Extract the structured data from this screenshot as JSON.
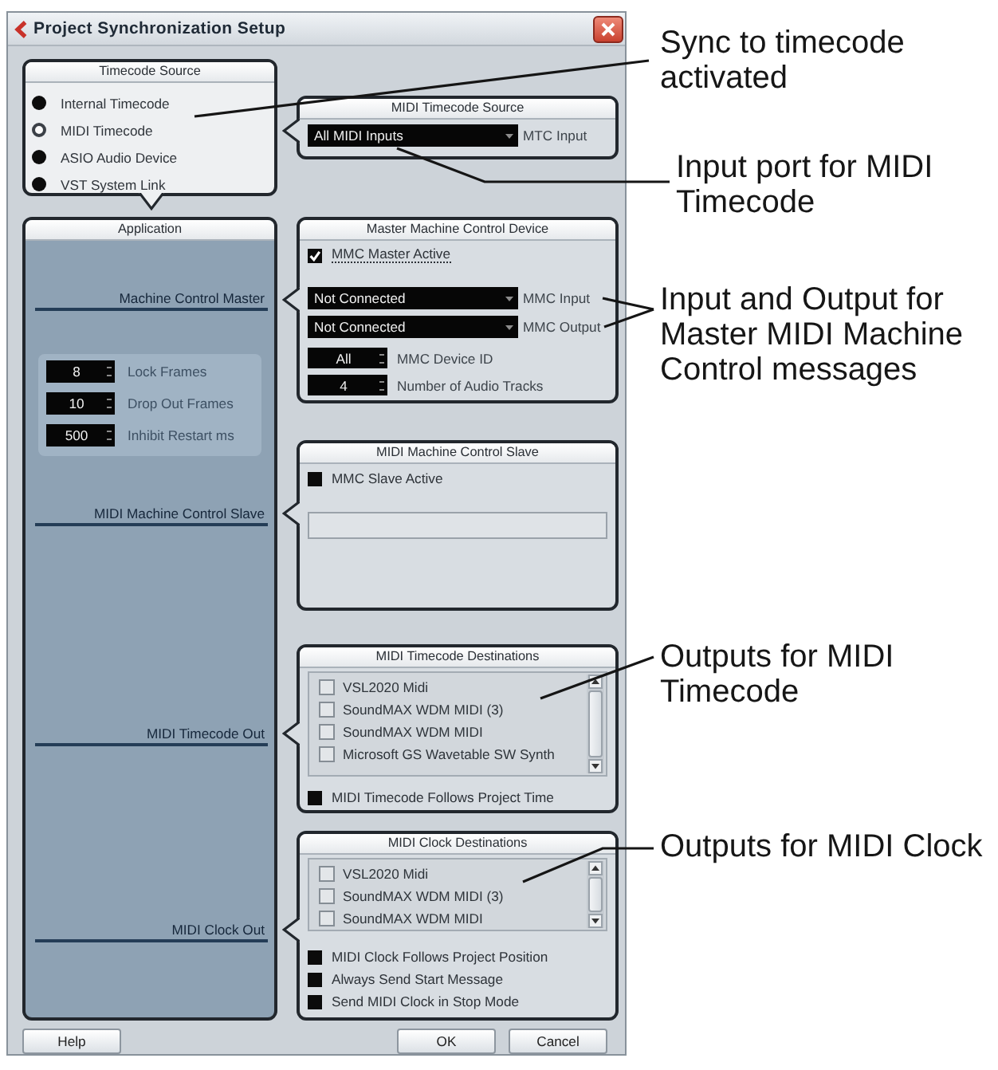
{
  "window": {
    "title": "Project Synchronization Setup"
  },
  "timecode_source": {
    "title": "Timecode Source",
    "options": [
      {
        "label": "Internal Timecode",
        "selected": false
      },
      {
        "label": "MIDI Timecode",
        "selected": true
      },
      {
        "label": "ASIO Audio Device",
        "selected": false
      },
      {
        "label": "VST System Link",
        "selected": false
      }
    ]
  },
  "midi_timecode_source": {
    "title": "MIDI Timecode Source",
    "input": {
      "value": "All MIDI Inputs",
      "label": "MTC Input"
    }
  },
  "application": {
    "title": "Application",
    "sections": [
      {
        "label": "Machine Control Master"
      },
      {
        "label": "MIDI Machine Control Slave"
      },
      {
        "label": "MIDI Timecode Out"
      },
      {
        "label": "MIDI Clock Out"
      }
    ],
    "frame_settings": [
      {
        "value": "8",
        "label": "Lock Frames"
      },
      {
        "value": "10",
        "label": "Drop Out Frames"
      },
      {
        "value": "500",
        "label": "Inhibit Restart ms"
      }
    ]
  },
  "master_machine_control": {
    "title": "Master Machine Control Device",
    "active": {
      "label": "MMC Master Active",
      "checked": true,
      "focused": true
    },
    "ports": [
      {
        "value": "Not Connected",
        "label": "MMC Input"
      },
      {
        "value": "Not Connected",
        "label": "MMC Output"
      }
    ],
    "settings": [
      {
        "value": "All",
        "label": "MMC Device ID"
      },
      {
        "value": "4",
        "label": "Number of Audio Tracks"
      }
    ]
  },
  "midi_machine_control_slave": {
    "title": "MIDI Machine Control Slave",
    "active": {
      "label": "MMC Slave Active",
      "checked": false
    }
  },
  "midi_timecode_destinations": {
    "title": "MIDI Timecode Destinations",
    "destinations": [
      {
        "label": "VSL2020 Midi",
        "checked": false
      },
      {
        "label": "SoundMAX WDM MIDI (3)",
        "checked": false
      },
      {
        "label": "SoundMAX WDM MIDI",
        "checked": false
      },
      {
        "label": "Microsoft GS Wavetable SW Synth",
        "checked": false
      }
    ],
    "options": [
      {
        "label": "MIDI Timecode Follows Project Time",
        "checked": false
      }
    ]
  },
  "midi_clock_destinations": {
    "title": "MIDI Clock Destinations",
    "destinations": [
      {
        "label": "VSL2020 Midi",
        "checked": false
      },
      {
        "label": "SoundMAX WDM MIDI (3)",
        "checked": false
      },
      {
        "label": "SoundMAX WDM MIDI",
        "checked": false
      }
    ],
    "options": [
      {
        "label": "MIDI Clock Follows Project Position",
        "checked": false
      },
      {
        "label": "Always Send Start Message",
        "checked": false
      },
      {
        "label": "Send MIDI Clock in Stop Mode",
        "checked": false
      }
    ]
  },
  "buttons": {
    "left": [
      {
        "label": "Help"
      }
    ],
    "right": [
      {
        "label": "OK"
      },
      {
        "label": "Cancel"
      }
    ]
  },
  "annotations": [
    {
      "text": "Sync to timecode activated"
    },
    {
      "text": "Input port for MIDI Timecode"
    },
    {
      "text": "Input and Output for Master MIDI Machine Control messages"
    },
    {
      "text": "Outputs for MIDI Timecode"
    },
    {
      "text": "Outputs for MIDI Clock"
    }
  ]
}
